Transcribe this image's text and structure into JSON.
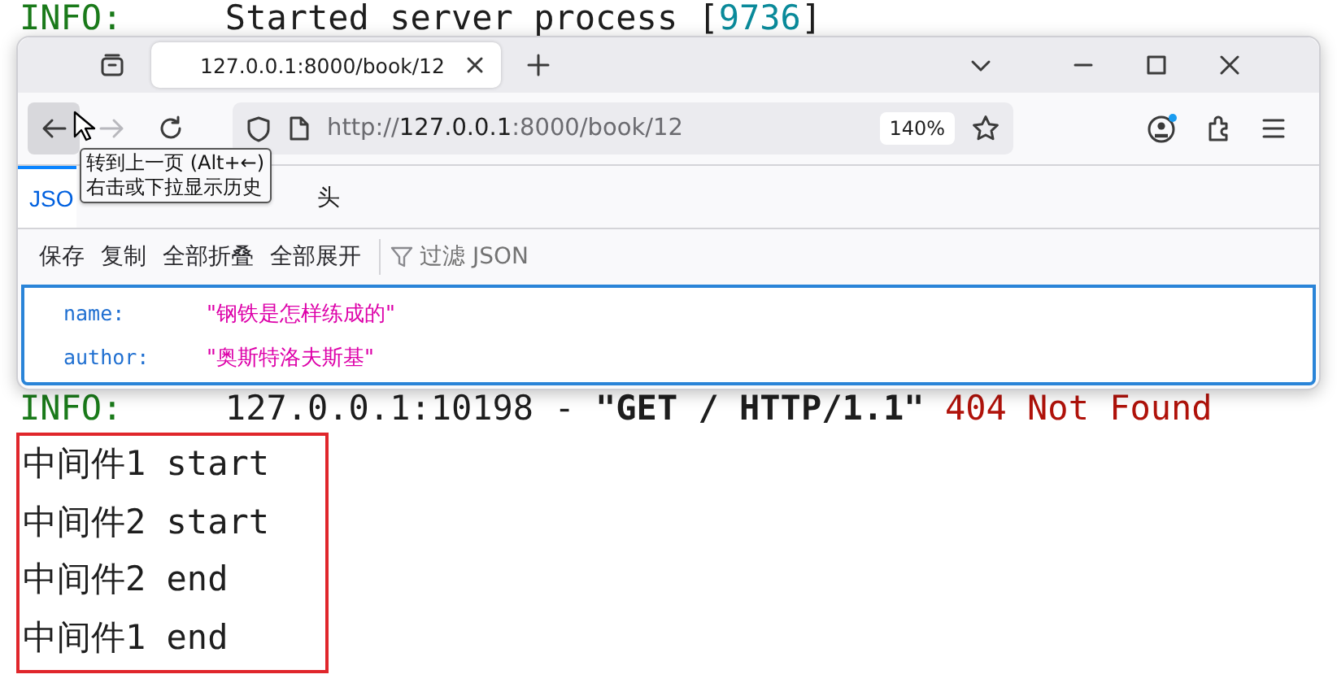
{
  "terminal_top": [
    {
      "text": "INFO:",
      "kind": "level"
    },
    {
      "text": "     Started server process [",
      "kind": "plain"
    },
    {
      "text": "9736",
      "kind": "number"
    },
    {
      "text": "]",
      "kind": "plain"
    }
  ],
  "browser": {
    "tab_title": "127.0.0.1:8000/book/12",
    "forward_disabled": true,
    "url": {
      "scheme": "http://",
      "host": "127.0.0.1",
      "path": ":8000/book/12"
    },
    "zoom": "140%",
    "tooltip": [
      "转到上一页 (Alt+←)",
      "右击或下拉显示历史"
    ],
    "viewer_tabs": [
      {
        "label": "JSO",
        "selected": true
      },
      {
        "label": "头",
        "selected": false
      }
    ],
    "toolbar": [
      "保存",
      "复制",
      "全部折叠",
      "全部展开"
    ],
    "filter": {
      "placeholder": "过滤 JSON"
    },
    "json_rows": [
      {
        "key": "name:",
        "value": "\"钢铁是怎样练成的\""
      },
      {
        "key": "author:",
        "value": "\"奥斯特洛夫斯基\""
      }
    ]
  },
  "terminal": [
    {
      "segments": [
        {
          "text": "INFO:",
          "kind": "level"
        },
        {
          "text": "     127.0.0.1:10198 - ",
          "kind": "plain"
        },
        {
          "text": "\"GET / HTTP/1.1\"",
          "kind": "bold"
        },
        {
          "text": " 404 Not Found",
          "kind": "error"
        }
      ]
    }
  ],
  "highlighted_lines": [
    "中间件1 start",
    "中间件2 start",
    "中间件2 end",
    "中间件1 end"
  ]
}
